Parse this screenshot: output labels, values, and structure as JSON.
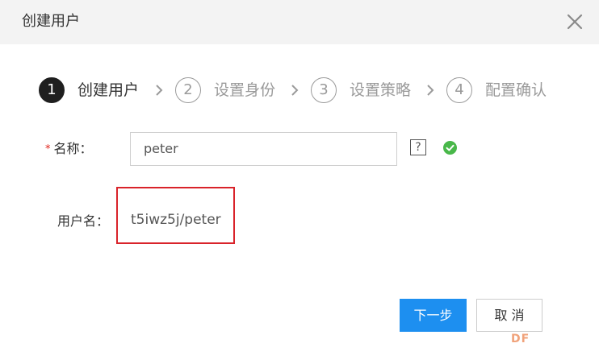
{
  "dialog": {
    "title": "创建用户",
    "close_icon": "close-icon"
  },
  "steps": [
    {
      "number": "1",
      "label": "创建用户",
      "state": "active"
    },
    {
      "number": "2",
      "label": "设置身份",
      "state": "pending"
    },
    {
      "number": "3",
      "label": "设置策略",
      "state": "pending"
    },
    {
      "number": "4",
      "label": "配置确认",
      "state": "pending"
    }
  ],
  "form": {
    "name_label": "名称",
    "name_colon": "：",
    "required_mark": "*",
    "name_value": "peter",
    "help_glyph": "?",
    "valid_icon": "check-circle-icon",
    "username_label": "用户名：",
    "username_value": "t5iwz5j/peter"
  },
  "buttons": {
    "next": "下一步",
    "cancel": "取 消"
  },
  "watermark": "DF",
  "colors": {
    "primary": "#1d8ff0",
    "required": "#e0231a",
    "valid": "#49b84a",
    "highlight_border": "#d9232a"
  }
}
